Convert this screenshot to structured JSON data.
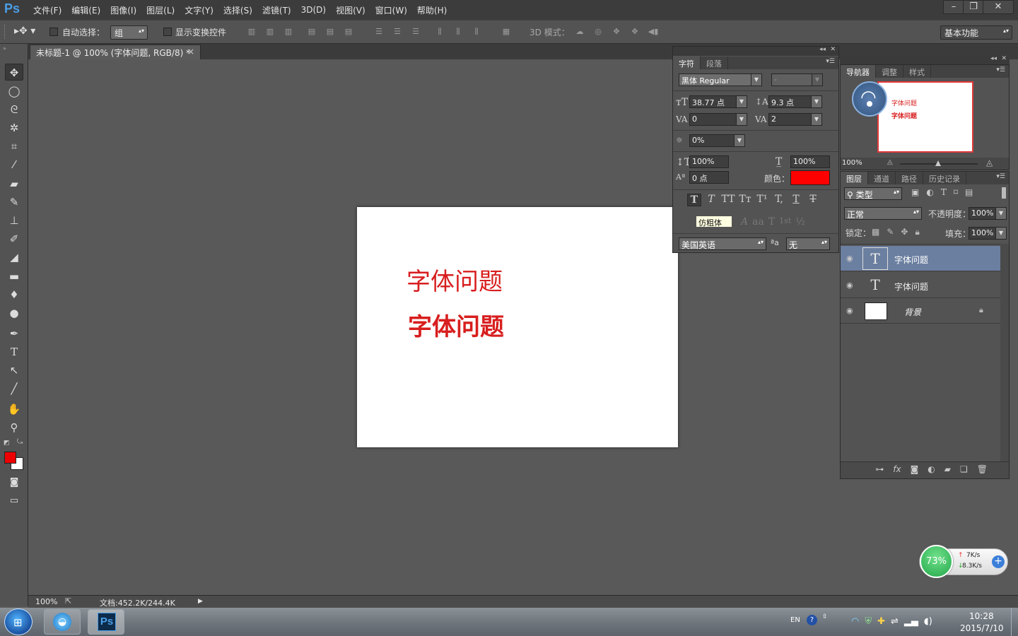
{
  "app": {
    "logo": "Ps"
  },
  "menu": [
    "文件(F)",
    "编辑(E)",
    "图像(I)",
    "图层(L)",
    "文字(Y)",
    "选择(S)",
    "滤镜(T)",
    "3D(D)",
    "视图(V)",
    "窗口(W)",
    "帮助(H)"
  ],
  "window_controls": {
    "minimize": "–",
    "restore": "❐",
    "close": "✕"
  },
  "options": {
    "auto_select_label": "自动选择：",
    "auto_select_value": "组",
    "show_transform_label": "显示变换控件",
    "mode3d_label": "3D 模式：",
    "workspace": "基本功能"
  },
  "document_tab": {
    "title": "未标题-1 @ 100% (字体问题, RGB/8) *",
    "close": "×"
  },
  "canvas": {
    "text_line1": "字体问题",
    "text_line2": "字体问题",
    "text_color": "#d81e1e"
  },
  "status": {
    "zoom": "100%",
    "doc_info": "文档:452.2K/244.4K"
  },
  "character_panel": {
    "tabs": [
      "字符",
      "段落"
    ],
    "font_family": "黑体 Regular",
    "font_style": "-",
    "font_size": "38.77 点",
    "leading": "9.3 点",
    "kerning": "0",
    "tracking": "2",
    "tsume": "0%",
    "vertical_scale": "100%",
    "horizontal_scale": "100%",
    "baseline_shift": "0 点",
    "color_label": "颜色：",
    "color_value": "#ff0000",
    "faux_bold_tooltip": "仿粗体",
    "language": "美国英语",
    "aa_label": "ªa",
    "antialias": "无",
    "style_buttons": [
      "T",
      "T",
      "TT",
      "Tт",
      "T¹",
      "T,",
      "T",
      "T"
    ],
    "opentype_buttons": [
      "A",
      "aa",
      "T",
      "1st",
      "½"
    ]
  },
  "navigator_panel": {
    "tabs": [
      "导航器",
      "调整",
      "样式"
    ],
    "thumb_line1": "字体问题",
    "thumb_line2": "字体问题",
    "zoom": "100%"
  },
  "layers_panel": {
    "tabs": [
      "图层",
      "通道",
      "路径",
      "历史记录"
    ],
    "filter_kind": "类型",
    "blend_mode": "正常",
    "opacity_label": "不透明度：",
    "opacity": "100%",
    "lock_label": "锁定：",
    "fill_label": "填充：",
    "fill": "100%",
    "layers": [
      {
        "name": "字体问题",
        "kind": "text",
        "selected": true
      },
      {
        "name": "字体问题",
        "kind": "text",
        "selected": false
      },
      {
        "name": "背景",
        "kind": "background",
        "selected": false
      }
    ]
  },
  "net_widget": {
    "percent": "73%",
    "up": "7K/s",
    "down": "8.3K/s"
  },
  "taskbar": {
    "lang": "EN",
    "time": "10:28",
    "date": "2015/7/10"
  }
}
